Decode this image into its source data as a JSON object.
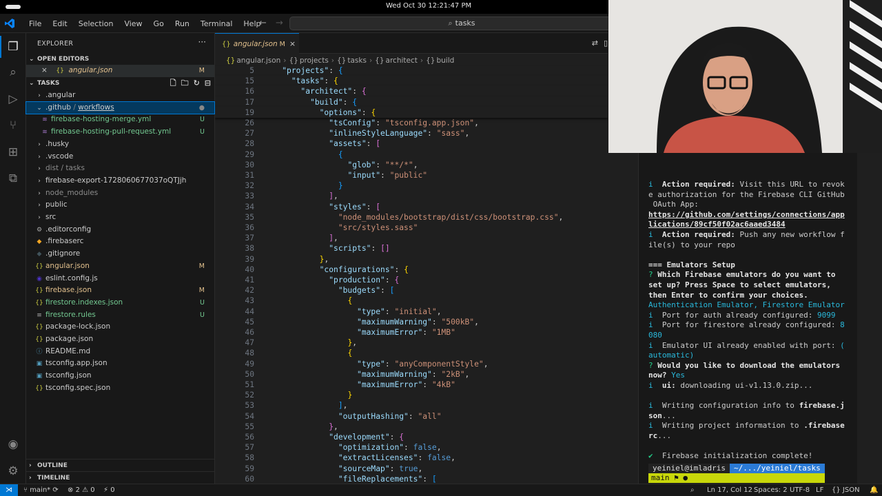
{
  "system": {
    "clock": "Wed Oct 30  12:21:47 PM"
  },
  "titlebar": {
    "menu": [
      "File",
      "Edit",
      "Selection",
      "View",
      "Go",
      "Run",
      "Terminal",
      "Help"
    ],
    "search": "tasks"
  },
  "activity": [
    "files-icon",
    "search-icon",
    "run-debug-icon",
    "source-control-icon",
    "extensions-icon",
    "remote-explorer-icon",
    "account-icon",
    "settings-icon"
  ],
  "sidebar": {
    "title": "EXPLORER",
    "more": "···",
    "open_editors_label": "OPEN EDITORS",
    "open_editor": {
      "name": "angular.json",
      "badge": "M",
      "close": "×",
      "icon": "{}"
    },
    "workspace_label": "TASKS",
    "tree": [
      {
        "name": ".angular",
        "kind": "folder",
        "color": "#cccccc",
        "badge": ""
      },
      {
        "name": ".github",
        "name2": "workflows",
        "kind": "folder-open",
        "color": "#cccccc",
        "badge": "●"
      },
      {
        "name": "firebase-hosting-merge.yml",
        "kind": "yml",
        "color": "#73c991",
        "badge": "U"
      },
      {
        "name": "firebase-hosting-pull-request.yml",
        "kind": "yml",
        "color": "#73c991",
        "badge": "U"
      },
      {
        "name": ".husky",
        "kind": "folder",
        "color": "#cccccc",
        "badge": ""
      },
      {
        "name": ".vscode",
        "kind": "folder",
        "color": "#cccccc",
        "badge": ""
      },
      {
        "name": "dist / tasks",
        "kind": "folder",
        "color": "#8c8c8c",
        "badge": ""
      },
      {
        "name": "firebase-export-1728060677037oQTJjh",
        "kind": "folder",
        "color": "#cccccc",
        "badge": ""
      },
      {
        "name": "node_modules",
        "kind": "folder",
        "color": "#8c8c8c",
        "badge": ""
      },
      {
        "name": "public",
        "kind": "folder",
        "color": "#cccccc",
        "badge": ""
      },
      {
        "name": "src",
        "kind": "folder",
        "color": "#cccccc",
        "badge": ""
      },
      {
        "name": ".editorconfig",
        "kind": "gear",
        "color": "#cccccc",
        "badge": ""
      },
      {
        "name": ".firebaserc",
        "kind": "fire",
        "color": "#cccccc",
        "badge": ""
      },
      {
        "name": ".gitignore",
        "kind": "git",
        "color": "#cccccc",
        "badge": ""
      },
      {
        "name": "angular.json",
        "kind": "json",
        "color": "#e2c08d",
        "badge": "M"
      },
      {
        "name": "eslint.config.js",
        "kind": "eslint",
        "color": "#cccccc",
        "badge": ""
      },
      {
        "name": "firebase.json",
        "kind": "json",
        "color": "#e2c08d",
        "badge": "M"
      },
      {
        "name": "firestore.indexes.json",
        "kind": "json",
        "color": "#73c991",
        "badge": "U"
      },
      {
        "name": "firestore.rules",
        "kind": "rules",
        "color": "#73c991",
        "badge": "U"
      },
      {
        "name": "package-lock.json",
        "kind": "json",
        "color": "#cccccc",
        "badge": ""
      },
      {
        "name": "package.json",
        "kind": "json",
        "color": "#cccccc",
        "badge": ""
      },
      {
        "name": "README.md",
        "kind": "info",
        "color": "#cccccc",
        "badge": ""
      },
      {
        "name": "tsconfig.app.json",
        "kind": "ts",
        "color": "#cccccc",
        "badge": ""
      },
      {
        "name": "tsconfig.json",
        "kind": "ts",
        "color": "#cccccc",
        "badge": ""
      },
      {
        "name": "tsconfig.spec.json",
        "kind": "json",
        "color": "#cccccc",
        "badge": ""
      }
    ],
    "outline_label": "OUTLINE",
    "timeline_label": "TIMELINE"
  },
  "editor": {
    "tab": {
      "name": "angular.json",
      "badge": "M",
      "close": "×"
    },
    "breadcrumb": [
      "angular.json",
      "projects",
      "tasks",
      "architect",
      "build"
    ],
    "lines": [
      {
        "n": "5",
        "t": "    \"projects\": {"
      },
      {
        "n": "15",
        "t": "      \"tasks\": {"
      },
      {
        "n": "16",
        "t": "        \"architect\": {"
      },
      {
        "n": "17",
        "t": "          \"build\": {"
      },
      {
        "n": "19",
        "t": "            \"options\": {"
      },
      {
        "n": "26",
        "t": "              \"tsConfig\": \"tsconfig.app.json\","
      },
      {
        "n": "27",
        "t": "              \"inlineStyleLanguage\": \"sass\","
      },
      {
        "n": "28",
        "t": "              \"assets\": ["
      },
      {
        "n": "29",
        "t": "                {"
      },
      {
        "n": "30",
        "t": "                  \"glob\": \"**/*\","
      },
      {
        "n": "31",
        "t": "                  \"input\": \"public\""
      },
      {
        "n": "32",
        "t": "                }"
      },
      {
        "n": "33",
        "t": "              ],"
      },
      {
        "n": "34",
        "t": "              \"styles\": ["
      },
      {
        "n": "35",
        "t": "                \"node_modules/bootstrap/dist/css/bootstrap.css\","
      },
      {
        "n": "36",
        "t": "                \"src/styles.sass\""
      },
      {
        "n": "37",
        "t": "              ],"
      },
      {
        "n": "38",
        "t": "              \"scripts\": []"
      },
      {
        "n": "39",
        "t": "            },"
      },
      {
        "n": "40",
        "t": "            \"configurations\": {"
      },
      {
        "n": "41",
        "t": "              \"production\": {"
      },
      {
        "n": "42",
        "t": "                \"budgets\": ["
      },
      {
        "n": "43",
        "t": "                  {"
      },
      {
        "n": "44",
        "t": "                    \"type\": \"initial\","
      },
      {
        "n": "45",
        "t": "                    \"maximumWarning\": \"500kB\","
      },
      {
        "n": "46",
        "t": "                    \"maximumError\": \"1MB\""
      },
      {
        "n": "47",
        "t": "                  },"
      },
      {
        "n": "48",
        "t": "                  {"
      },
      {
        "n": "49",
        "t": "                    \"type\": \"anyComponentStyle\","
      },
      {
        "n": "50",
        "t": "                    \"maximumWarning\": \"2kB\","
      },
      {
        "n": "51",
        "t": "                    \"maximumError\": \"4kB\""
      },
      {
        "n": "52",
        "t": "                  }"
      },
      {
        "n": "53",
        "t": "                ],"
      },
      {
        "n": "54",
        "t": "                \"outputHashing\": \"all\""
      },
      {
        "n": "55",
        "t": "              },"
      },
      {
        "n": "56",
        "t": "              \"development\": {"
      },
      {
        "n": "57",
        "t": "                \"optimization\": false,"
      },
      {
        "n": "58",
        "t": "                \"extractLicenses\": false,"
      },
      {
        "n": "59",
        "t": "                \"sourceMap\": true,"
      },
      {
        "n": "60",
        "t": "                \"fileReplacements\": ["
      }
    ]
  },
  "terminal": {
    "lines": [
      [
        {
          "c": "tc",
          "t": "i  "
        },
        {
          "c": "tb",
          "t": "Action required:"
        },
        {
          "c": "",
          "t": " Visit this URL to revok"
        }
      ],
      [
        {
          "c": "",
          "t": "e authorization for the Firebase CLI GitHub"
        }
      ],
      [
        {
          "c": "",
          "t": " OAuth App:"
        }
      ],
      [
        {
          "c": "tu",
          "t": "https://github.com/settings/connections/app"
        }
      ],
      [
        {
          "c": "tu",
          "t": "lications/89cf50f02ac6aaed3484"
        }
      ],
      [
        {
          "c": "tc",
          "t": "i  "
        },
        {
          "c": "tb",
          "t": "Action required:"
        },
        {
          "c": "",
          "t": " Push any new workflow f"
        }
      ],
      [
        {
          "c": "",
          "t": "ile(s) to your repo"
        }
      ],
      [
        {
          "c": "",
          "t": ""
        }
      ],
      [
        {
          "c": "tb",
          "t": "=== Emulators Setup"
        }
      ],
      [
        {
          "c": "tg",
          "t": "? "
        },
        {
          "c": "tb",
          "t": "Which Firebase emulators do you want to"
        }
      ],
      [
        {
          "c": "tb",
          "t": "set up? Press Space to select emulators,"
        }
      ],
      [
        {
          "c": "tb",
          "t": "then Enter to confirm your choices."
        }
      ],
      [
        {
          "c": "tc",
          "t": "Authentication Emulator, Firestore Emulator"
        }
      ],
      [
        {
          "c": "tc",
          "t": "i  "
        },
        {
          "c": "",
          "t": "Port for auth already configured: "
        },
        {
          "c": "tc",
          "t": "9099"
        }
      ],
      [
        {
          "c": "tc",
          "t": "i  "
        },
        {
          "c": "",
          "t": "Port for firestore already configured: "
        },
        {
          "c": "tc",
          "t": "8"
        }
      ],
      [
        {
          "c": "tc",
          "t": "080"
        }
      ],
      [
        {
          "c": "tc",
          "t": "i  "
        },
        {
          "c": "",
          "t": "Emulator UI already enabled with port: "
        },
        {
          "c": "tc",
          "t": "("
        }
      ],
      [
        {
          "c": "tc",
          "t": "automatic)"
        }
      ],
      [
        {
          "c": "tg",
          "t": "? "
        },
        {
          "c": "tb",
          "t": "Would you like to download the emulators"
        }
      ],
      [
        {
          "c": "tb",
          "t": "now?"
        },
        {
          "c": "tc",
          "t": " Yes"
        }
      ],
      [
        {
          "c": "tc",
          "t": "i  "
        },
        {
          "c": "tb",
          "t": "ui:"
        },
        {
          "c": "",
          "t": " downloading ui-v1.13.0.zip..."
        }
      ],
      [
        {
          "c": "",
          "t": ""
        }
      ],
      [
        {
          "c": "tc",
          "t": "i  "
        },
        {
          "c": "",
          "t": "Writing configuration info to "
        },
        {
          "c": "tb",
          "t": "firebase.j"
        }
      ],
      [
        {
          "c": "tb",
          "t": "son"
        },
        {
          "c": "",
          "t": "..."
        }
      ],
      [
        {
          "c": "tc",
          "t": "i  "
        },
        {
          "c": "",
          "t": "Writing project information to "
        },
        {
          "c": "tb",
          "t": ".firebase"
        }
      ],
      [
        {
          "c": "tb",
          "t": "rc"
        },
        {
          "c": "",
          "t": "..."
        }
      ],
      [
        {
          "c": "",
          "t": ""
        }
      ],
      [
        {
          "c": "tg",
          "t": "✔  "
        },
        {
          "c": "",
          "t": "Firebase initialization complete!"
        }
      ]
    ],
    "prompt": {
      "user": "yeiniel@imladris",
      "path": "~/.../yeiniel/tasks",
      "branch": "main ⚑ ●"
    }
  },
  "statusbar": {
    "branch": "main*",
    "errors": "2",
    "warnings": "0",
    "ports": "0",
    "position": "Ln 17, Col 12",
    "spaces": "Spaces: 2",
    "encoding": "UTF-8",
    "eol": "LF",
    "language": "JSON"
  },
  "colors": {
    "accent": "#0078d4",
    "modified": "#e2c08d",
    "untracked": "#73c991"
  }
}
